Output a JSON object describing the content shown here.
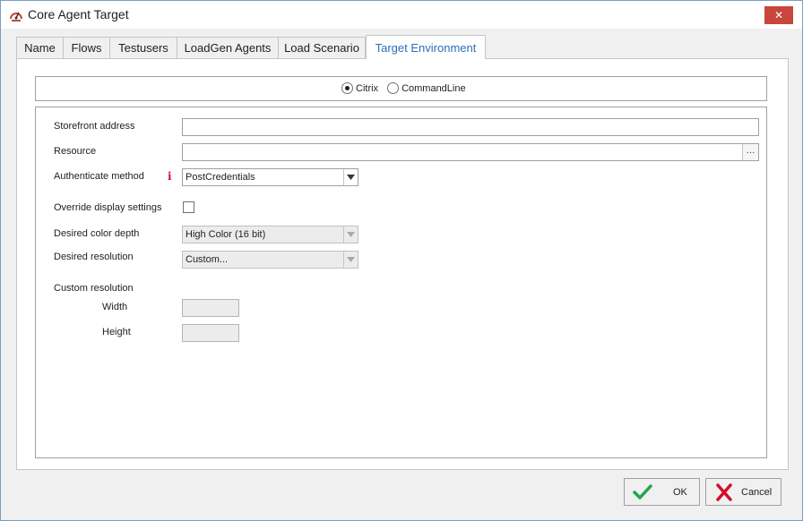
{
  "window": {
    "title": "Core Agent Target"
  },
  "colors": {
    "accent": "#2c6fb7",
    "close": "#c9463d",
    "ok": "#21a64c",
    "cancel": "#d10f2c",
    "info": "#d10f2c"
  },
  "tabs": [
    {
      "label": "Name"
    },
    {
      "label": "Flows"
    },
    {
      "label": "Testusers"
    },
    {
      "label": "LoadGen Agents"
    },
    {
      "label": "Load Scenario"
    },
    {
      "label": "Target Environment",
      "active": true
    }
  ],
  "environment": {
    "options": [
      {
        "label": "Citrix",
        "checked": true
      },
      {
        "label": "CommandLine",
        "checked": false
      }
    ]
  },
  "form": {
    "storefront_label": "Storefront address",
    "storefront_value": "",
    "resource_label": "Resource",
    "resource_value": "",
    "resource_browse": "···",
    "auth_label": "Authenticate method",
    "auth_info_icon": "i",
    "auth_value": "PostCredentials",
    "override_label": "Override display settings",
    "override_checked": false,
    "color_depth_label": "Desired color depth",
    "color_depth_value": "High Color (16 bit)",
    "resolution_label": "Desired resolution",
    "resolution_value": "Custom...",
    "custom_resolution_label": "Custom resolution",
    "width_label": "Width",
    "width_value": "",
    "height_label": "Height",
    "height_value": ""
  },
  "buttons": {
    "ok_label": "OK",
    "cancel_label": "Cancel"
  },
  "icons": {
    "app": "speedometer-icon",
    "close": "close-icon",
    "ok": "checkmark-icon",
    "cancel": "cross-icon"
  }
}
